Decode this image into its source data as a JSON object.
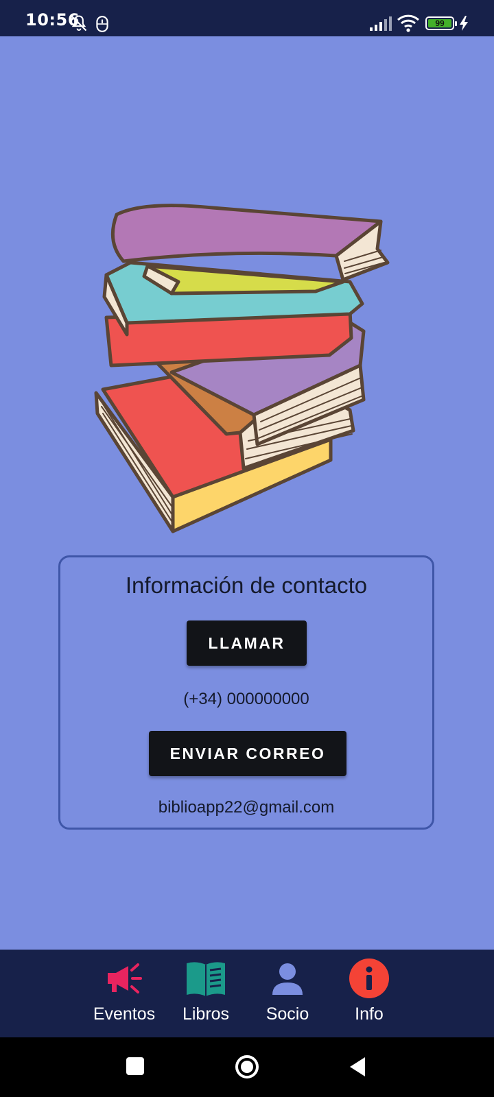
{
  "status_bar": {
    "time": "10:56",
    "battery_level": "99",
    "icons": [
      "bell-off-icon",
      "mouse-icon",
      "signal-icon",
      "wifi-icon",
      "battery-icon",
      "charging-icon"
    ]
  },
  "contact": {
    "title": "Información de contacto",
    "call_button": "LLAMAR",
    "phone": "(+34) 000000000",
    "mail_button": "ENVIAR CORREO",
    "email": "biblioapp22@gmail.com"
  },
  "bottom_nav": {
    "items": [
      {
        "label": "Eventos",
        "icon": "megaphone-icon",
        "color": "#e8245f"
      },
      {
        "label": "Libros",
        "icon": "open-book-icon",
        "color": "#1b9a8a"
      },
      {
        "label": "Socio",
        "icon": "person-icon",
        "color": "#7b8ee0"
      },
      {
        "label": "Info",
        "icon": "info-icon",
        "color": "#f44336"
      }
    ]
  },
  "colors": {
    "background": "#7b8ee0",
    "bars": "#17214a",
    "button": "#121418",
    "card_border": "#3f56a8"
  }
}
